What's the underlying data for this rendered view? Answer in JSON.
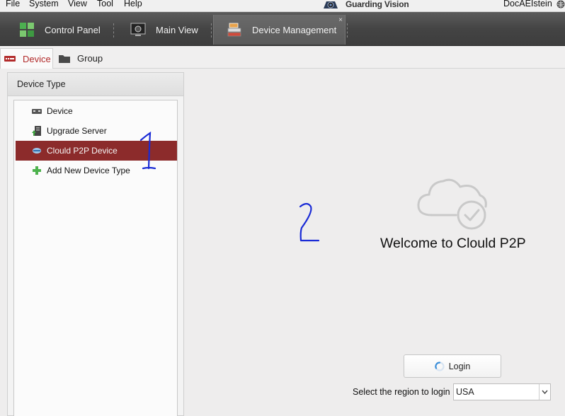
{
  "menu": {
    "items": [
      "File",
      "System",
      "View",
      "Tool",
      "Help"
    ]
  },
  "app": {
    "title": "Guarding Vision",
    "logo_icon": "camera-logo-icon"
  },
  "user": {
    "name": "DocAEIstein",
    "icon": "globe-icon"
  },
  "toolbar": {
    "tabs": [
      {
        "label": "Control Panel",
        "icon": "grid-icon"
      },
      {
        "label": "Main View",
        "icon": "monitor-camera-icon"
      },
      {
        "label": "Device Management",
        "icon": "device-stack-icon",
        "active": true,
        "close": "×"
      }
    ]
  },
  "subtabs": [
    {
      "label": "Device",
      "icon": "device-icon",
      "active": true
    },
    {
      "label": "Group",
      "icon": "folder-icon"
    }
  ],
  "panel": {
    "header": "Device Type",
    "items": [
      {
        "label": "Device",
        "icon": "dvr-icon"
      },
      {
        "label": "Upgrade Server",
        "icon": "server-upgrade-icon"
      },
      {
        "label": "Clould P2P Device",
        "icon": "cloud-device-icon",
        "selected": true
      },
      {
        "label": "Add New Device Type",
        "icon": "plus-icon"
      }
    ]
  },
  "annotations": {
    "one": "1",
    "two": "2"
  },
  "main": {
    "welcome": "Welcome to Clould P2P",
    "login_label": "Login",
    "region_label": "Select the region to login",
    "region_value": "USA"
  },
  "colors": {
    "accent": "#8c2b2b",
    "active_text": "#b22b2b",
    "annotation_ink": "#1a2bd6"
  }
}
